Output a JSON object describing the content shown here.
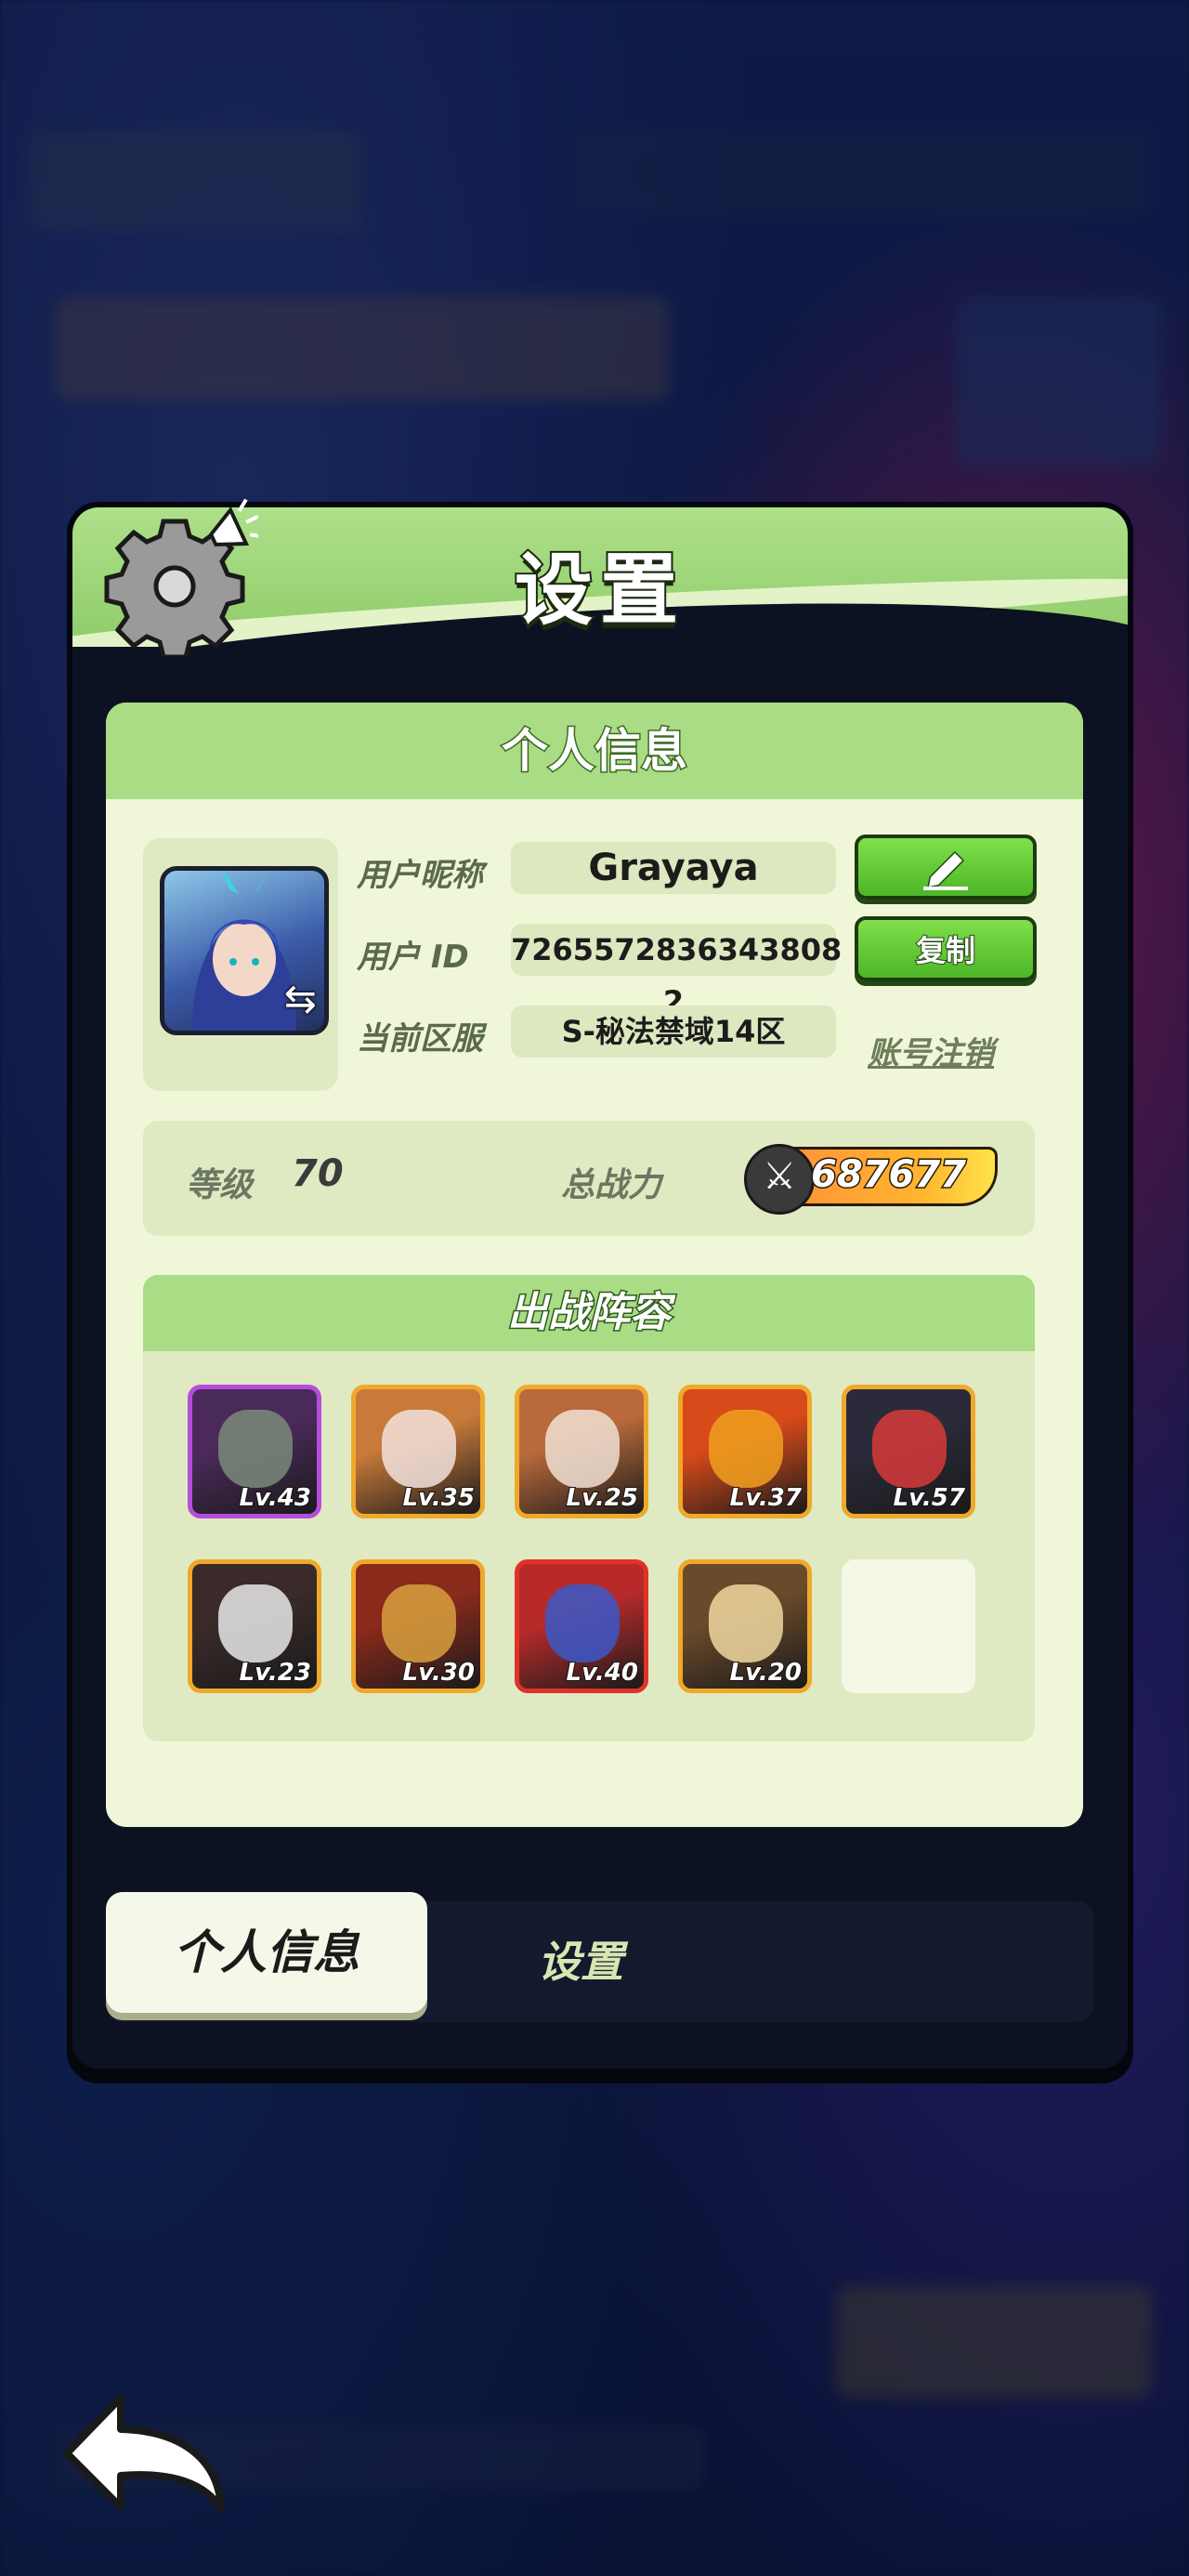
{
  "panel": {
    "title": "设置"
  },
  "profile": {
    "section_title": "个人信息",
    "nickname_label": "用户昵称",
    "nickname": "Grayaya",
    "id_label": "用户  ID",
    "user_id": "7265572836343808​2",
    "server_label": "当前区服",
    "server": "S-秘法禁域14区",
    "copy_button": "复制",
    "cancel_account": "账号注销"
  },
  "stats": {
    "level_label": "等级",
    "level": "70",
    "power_label": "总战力",
    "power": "687677"
  },
  "team": {
    "title": "出战阵容",
    "heroes": [
      {
        "lv": "Lv.43",
        "frame": "purple"
      },
      {
        "lv": "Lv.35",
        "frame": "gold"
      },
      {
        "lv": "Lv.25",
        "frame": "gold"
      },
      {
        "lv": "Lv.37",
        "frame": "gold"
      },
      {
        "lv": "Lv.57",
        "frame": "gold"
      },
      {
        "lv": "Lv.23",
        "frame": "gold"
      },
      {
        "lv": "Lv.30",
        "frame": "gold"
      },
      {
        "lv": "Lv.40",
        "frame": "red"
      },
      {
        "lv": "Lv.20",
        "frame": "gold"
      }
    ]
  },
  "tabs": {
    "active": "个人信息",
    "inactive": "设置"
  },
  "icons": [
    "gear-icon",
    "megaphone-icon",
    "swap-icon",
    "edit-pencil-icon",
    "crossed-swords-icon",
    "back-arrow-icon"
  ]
}
